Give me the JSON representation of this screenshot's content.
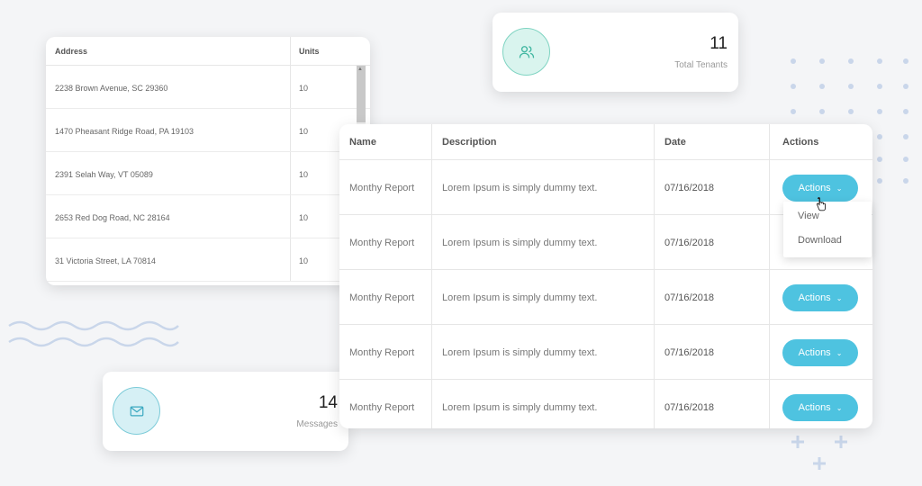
{
  "addresses": {
    "headers": {
      "address": "Address",
      "units": "Units"
    },
    "rows": [
      {
        "address": "2238 Brown Avenue, SC 29360",
        "units": "10"
      },
      {
        "address": "1470 Pheasant Ridge Road, PA 19103",
        "units": "10"
      },
      {
        "address": "2391 Selah Way, VT 05089",
        "units": "10"
      },
      {
        "address": "2653 Red Dog Road, NC 28164",
        "units": "10"
      },
      {
        "address": "31 Victoria Street, LA 70814",
        "units": "10"
      }
    ]
  },
  "tenants": {
    "count": "11",
    "label": "Total Tenants",
    "icon": "users-icon"
  },
  "messages": {
    "count": "14",
    "label": "Messages",
    "icon": "envelope-icon"
  },
  "reports": {
    "headers": {
      "name": "Name",
      "description": "Description",
      "date": "Date",
      "actions": "Actions"
    },
    "rows": [
      {
        "name": "Monthy Report",
        "description": "Lorem Ipsum is simply dummy text.",
        "date": "07/16/2018",
        "action": "Actions"
      },
      {
        "name": "Monthy Report",
        "description": "Lorem Ipsum is simply dummy text.",
        "date": "07/16/2018",
        "action": ""
      },
      {
        "name": "Monthy Report",
        "description": "Lorem Ipsum is simply dummy text.",
        "date": "07/16/2018",
        "action": "Actions"
      },
      {
        "name": "Monthy Report",
        "description": "Lorem Ipsum is simply dummy text.",
        "date": "07/16/2018",
        "action": "Actions"
      },
      {
        "name": "Monthy Report",
        "description": "Lorem Ipsum is simply dummy text.",
        "date": "07/16/2018",
        "action": "Actions"
      }
    ],
    "dropdown": [
      "View",
      "Download"
    ]
  },
  "colors": {
    "accent": "#4ec3e0",
    "teal": "#7fd4c2",
    "background": "#f4f5f7"
  }
}
